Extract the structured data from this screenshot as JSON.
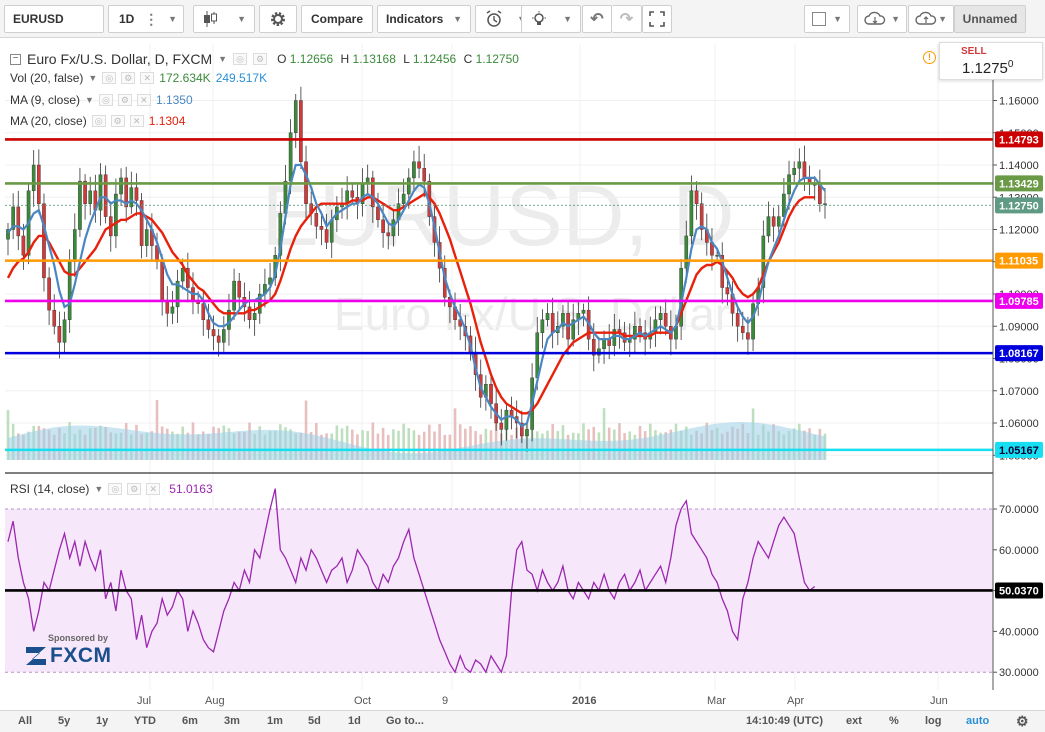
{
  "toolbar": {
    "symbol": "EURUSD",
    "interval": "1D",
    "compare_label": "Compare",
    "indicators_label": "Indicators",
    "layout_name": "Unnamed"
  },
  "legend": {
    "title": "Euro Fx/U.S. Dollar, D, FXCM",
    "o_label": "O",
    "o": "1.12656",
    "h_label": "H",
    "h": "1.13168",
    "l_label": "L",
    "l": "1.12456",
    "c_label": "C",
    "c": "1.12750",
    "vol_label": "Vol (20, false)",
    "vol_a": "172.634K",
    "vol_b": "249.517K",
    "ma9_label": "MA (9, close)",
    "ma9": "1.1350",
    "ma20_label": "MA (20, close)",
    "ma20": "1.1304",
    "rsi_label": "RSI (14, close)",
    "rsi": "51.0163"
  },
  "watermark": {
    "symbol": "EURUSD, D",
    "desc": "Euro Fx/U.S. Dollar"
  },
  "sell": {
    "label": "SELL",
    "price": "1.1275",
    "pip": "0"
  },
  "sponsor": {
    "text": "Sponsored by",
    "brand": "FXCM"
  },
  "price_axis": [
    "1.16000",
    "1.15000",
    "1.14000",
    "1.13000",
    "1.12000",
    "1.11000",
    "1.10000",
    "1.09000",
    "1.08000",
    "1.07000",
    "1.06000",
    "1.05000"
  ],
  "price_lines": [
    {
      "value": 1.14793,
      "label": "1.14793",
      "color": "#cc0000"
    },
    {
      "value": 1.13429,
      "label": "1.13429",
      "color": "#6a9a45"
    },
    {
      "value": 1.1275,
      "label": "1.12750",
      "color": "#5f9a84"
    },
    {
      "value": 1.11035,
      "label": "1.11035",
      "color": "#ff9a00"
    },
    {
      "value": 1.09785,
      "label": "1.09785",
      "color": "#ee00ee"
    },
    {
      "value": 1.08167,
      "label": "1.08167",
      "color": "#0000dd"
    },
    {
      "value": 1.05167,
      "label": "1.05167",
      "color": "#17dff2"
    }
  ],
  "rsi_axis": [
    "70.0000",
    "60.0000",
    "50.0000",
    "40.0000",
    "30.0000"
  ],
  "rsi_line": {
    "value": 50.037,
    "label": "50.0370"
  },
  "time_axis": [
    "Jul",
    "Aug",
    "Oct",
    "9",
    "2016",
    "Mar",
    "Apr",
    "Jun"
  ],
  "bottombar": {
    "ranges": [
      "All",
      "5y",
      "1y",
      "YTD",
      "6m",
      "3m",
      "1m",
      "5d",
      "1d"
    ],
    "goto": "Go to...",
    "time": "14:10:49 (UTC)",
    "ext": "ext",
    "pct": "%",
    "log": "log",
    "auto": "auto"
  },
  "colors": {
    "ma9": "#4a87c2",
    "ma20": "#e8200c",
    "up": "#3a8a3a",
    "down": "#d23a3a",
    "rsi": "#9c27b0",
    "volume": "#9ccfe8"
  },
  "chart_data": {
    "type": "line",
    "x_start": "2015-05-01",
    "x_end": "2016-06-10",
    "ylim": [
      1.045,
      1.1665
    ],
    "close": [
      1.12,
      1.127,
      1.118,
      1.112,
      1.132,
      1.14,
      1.128,
      1.105,
      1.095,
      1.09,
      1.085,
      1.092,
      1.11,
      1.12,
      1.135,
      1.128,
      1.132,
      1.126,
      1.137,
      1.124,
      1.118,
      1.131,
      1.136,
      1.127,
      1.133,
      1.129,
      1.115,
      1.12,
      1.115,
      1.11,
      1.098,
      1.094,
      1.096,
      1.104,
      1.108,
      1.102,
      1.098,
      1.097,
      1.092,
      1.089,
      1.087,
      1.085,
      1.089,
      1.095,
      1.104,
      1.099,
      1.096,
      1.092,
      1.094,
      1.1,
      1.103,
      1.105,
      1.112,
      1.125,
      1.135,
      1.15,
      1.16,
      1.141,
      1.128,
      1.125,
      1.121,
      1.12,
      1.116,
      1.123,
      1.127,
      1.128,
      1.132,
      1.13,
      1.128,
      1.134,
      1.136,
      1.127,
      1.123,
      1.119,
      1.118,
      1.123,
      1.128,
      1.131,
      1.136,
      1.141,
      1.139,
      1.135,
      1.124,
      1.116,
      1.108,
      1.099,
      1.096,
      1.092,
      1.09,
      1.087,
      1.082,
      1.075,
      1.068,
      1.072,
      1.066,
      1.06,
      1.058,
      1.064,
      1.062,
      1.06,
      1.056,
      1.058,
      1.074,
      1.088,
      1.092,
      1.094,
      1.088,
      1.09,
      1.094,
      1.086,
      1.092,
      1.094,
      1.095,
      1.086,
      1.081,
      1.083,
      1.086,
      1.084,
      1.089,
      1.088,
      1.085,
      1.086,
      1.09,
      1.088,
      1.086,
      1.088,
      1.092,
      1.094,
      1.09,
      1.086,
      1.09,
      1.108,
      1.118,
      1.132,
      1.128,
      1.12,
      1.116,
      1.112,
      1.112,
      1.102,
      1.1,
      1.094,
      1.09,
      1.088,
      1.086,
      1.097,
      1.102,
      1.118,
      1.124,
      1.121,
      1.124,
      1.131,
      1.137,
      1.139,
      1.141,
      1.136,
      1.134,
      1.134,
      1.128,
      1.128
    ],
    "ma9": [
      1.119,
      1.121,
      1.121,
      1.12,
      1.122,
      1.125,
      1.126,
      1.121,
      1.115,
      1.109,
      1.101,
      1.096,
      1.097,
      1.103,
      1.11,
      1.117,
      1.122,
      1.126,
      1.13,
      1.13,
      1.128,
      1.129,
      1.129,
      1.128,
      1.129,
      1.128,
      1.126,
      1.123,
      1.12,
      1.116,
      1.111,
      1.106,
      1.103,
      1.103,
      1.102,
      1.101,
      1.1,
      1.1,
      1.098,
      1.094,
      1.091,
      1.09,
      1.09,
      1.091,
      1.093,
      1.095,
      1.097,
      1.098,
      1.098,
      1.099,
      1.1,
      1.102,
      1.106,
      1.114,
      1.124,
      1.134,
      1.14,
      1.14,
      1.137,
      1.133,
      1.128,
      1.125,
      1.121,
      1.123,
      1.125,
      1.126,
      1.127,
      1.128,
      1.128,
      1.13,
      1.131,
      1.13,
      1.128,
      1.125,
      1.122,
      1.121,
      1.123,
      1.126,
      1.129,
      1.132,
      1.134,
      1.133,
      1.128,
      1.121,
      1.113,
      1.105,
      1.1,
      1.096,
      1.093,
      1.089,
      1.084,
      1.077,
      1.071,
      1.068,
      1.065,
      1.063,
      1.061,
      1.062,
      1.062,
      1.061,
      1.059,
      1.06,
      1.066,
      1.073,
      1.08,
      1.086,
      1.088,
      1.089,
      1.091,
      1.09,
      1.091,
      1.092,
      1.093,
      1.091,
      1.088,
      1.086,
      1.086,
      1.086,
      1.087,
      1.087,
      1.086,
      1.086,
      1.087,
      1.088,
      1.087,
      1.088,
      1.089,
      1.09,
      1.089,
      1.088,
      1.09,
      1.097,
      1.105,
      1.114,
      1.12,
      1.121,
      1.12,
      1.116,
      1.114,
      1.11,
      1.105,
      1.1,
      1.096,
      1.093,
      1.091,
      1.093,
      1.097,
      1.104,
      1.11,
      1.114,
      1.118,
      1.123,
      1.128,
      1.132,
      1.135,
      1.136,
      1.136,
      1.136,
      1.134,
      1.132
    ],
    "ma20": [
      1.105,
      1.108,
      1.11,
      1.111,
      1.113,
      1.116,
      1.118,
      1.118,
      1.116,
      1.113,
      1.11,
      1.107,
      1.106,
      1.106,
      1.108,
      1.11,
      1.112,
      1.114,
      1.117,
      1.12,
      1.121,
      1.122,
      1.123,
      1.123,
      1.124,
      1.125,
      1.125,
      1.124,
      1.123,
      1.121,
      1.119,
      1.116,
      1.113,
      1.111,
      1.109,
      1.106,
      1.104,
      1.102,
      1.101,
      1.099,
      1.097,
      1.095,
      1.094,
      1.094,
      1.094,
      1.094,
      1.094,
      1.095,
      1.095,
      1.096,
      1.097,
      1.098,
      1.1,
      1.104,
      1.109,
      1.114,
      1.118,
      1.121,
      1.123,
      1.125,
      1.127,
      1.128,
      1.128,
      1.128,
      1.128,
      1.128,
      1.128,
      1.129,
      1.129,
      1.129,
      1.13,
      1.13,
      1.129,
      1.128,
      1.127,
      1.126,
      1.126,
      1.127,
      1.128,
      1.129,
      1.13,
      1.131,
      1.13,
      1.128,
      1.125,
      1.121,
      1.117,
      1.112,
      1.107,
      1.102,
      1.097,
      1.091,
      1.085,
      1.08,
      1.075,
      1.071,
      1.068,
      1.066,
      1.065,
      1.064,
      1.063,
      1.063,
      1.064,
      1.066,
      1.069,
      1.072,
      1.075,
      1.078,
      1.081,
      1.083,
      1.085,
      1.086,
      1.087,
      1.088,
      1.088,
      1.088,
      1.088,
      1.088,
      1.088,
      1.088,
      1.087,
      1.087,
      1.087,
      1.087,
      1.087,
      1.087,
      1.088,
      1.088,
      1.088,
      1.088,
      1.09,
      1.094,
      1.098,
      1.102,
      1.106,
      1.108,
      1.109,
      1.109,
      1.11,
      1.109,
      1.107,
      1.105,
      1.102,
      1.1,
      1.099,
      1.1,
      1.102,
      1.106,
      1.11,
      1.113,
      1.116,
      1.12,
      1.124,
      1.127,
      1.129,
      1.13,
      1.13,
      1.13
    ],
    "rsi_ylim": [
      27,
      73
    ],
    "rsi": [
      62,
      67,
      58,
      52,
      48,
      40,
      45,
      52,
      50,
      55,
      60,
      64,
      58,
      62,
      56,
      62,
      58,
      55,
      60,
      48,
      52,
      45,
      55,
      50,
      48,
      38,
      44,
      36,
      40,
      42,
      48,
      44,
      46,
      50,
      48,
      40,
      45,
      42,
      38,
      36,
      35,
      40,
      45,
      48,
      52,
      50,
      55,
      52,
      60,
      58,
      64,
      70,
      75,
      60,
      58,
      55,
      52,
      58,
      55,
      60,
      58,
      55,
      52,
      55,
      56,
      58,
      52,
      55,
      60,
      58,
      56,
      52,
      50,
      54,
      52,
      56,
      58,
      62,
      65,
      58,
      54,
      50,
      46,
      42,
      38,
      35,
      32,
      30,
      34,
      31,
      30,
      33,
      32,
      30,
      34,
      32,
      30,
      34,
      50,
      60,
      62,
      55,
      54,
      50,
      55,
      52,
      50,
      52,
      56,
      50,
      48,
      52,
      50,
      48,
      52,
      50,
      54,
      50,
      48,
      52,
      54,
      50,
      52,
      55,
      50,
      52,
      54,
      56,
      52,
      58,
      66,
      70,
      72,
      64,
      62,
      60,
      58,
      54,
      52,
      48,
      45,
      40,
      38,
      48,
      52,
      58,
      62,
      60,
      58,
      62,
      66,
      68,
      66,
      64,
      58,
      52,
      50,
      51
    ]
  }
}
